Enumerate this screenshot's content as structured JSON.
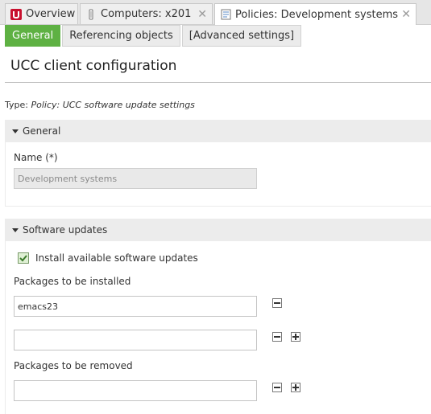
{
  "tabs": [
    {
      "label": "Overview",
      "icon": "ucs-logo-icon",
      "active": false
    },
    {
      "label": "Computers: x201",
      "icon": "computer-icon",
      "active": false
    },
    {
      "label": "Policies: Development systems",
      "icon": "policy-document-icon",
      "active": true
    }
  ],
  "subtabs": [
    {
      "label": "General",
      "active": true
    },
    {
      "label": "Referencing objects",
      "active": false
    },
    {
      "label": "[Advanced settings]",
      "active": false
    }
  ],
  "page_title": "UCC client configuration",
  "type_line": {
    "prefix": "Type: ",
    "value": "Policy: UCC software update settings"
  },
  "general_section": {
    "title": "General",
    "name_label": "Name (*)",
    "name_value": "Development systems"
  },
  "software_section": {
    "title": "Software updates",
    "install_updates_label": "Install available software updates",
    "install_updates_checked": true,
    "packages_install_label": "Packages to be installed",
    "packages_install": [
      "emacs23",
      ""
    ],
    "packages_remove_label": "Packages to be removed",
    "packages_remove": [
      ""
    ]
  },
  "colors": {
    "accent": "#5eb143",
    "brand": "#c8102e"
  }
}
